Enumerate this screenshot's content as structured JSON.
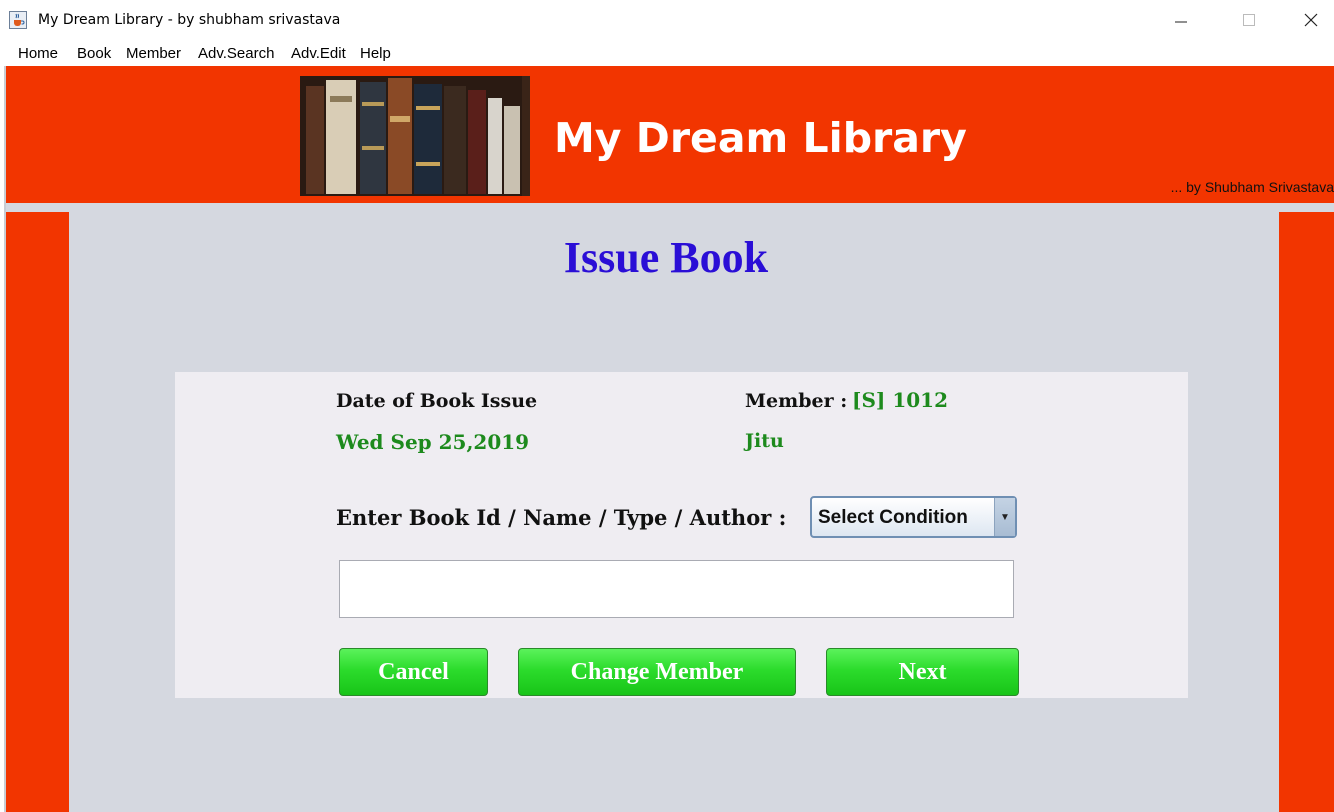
{
  "window": {
    "title": "My Dream Library - by shubham srivastava",
    "controls": {
      "minimize": "–",
      "maximize": "□",
      "close": "✕"
    }
  },
  "menu": {
    "items": [
      {
        "label": "Home"
      },
      {
        "label": "Book"
      },
      {
        "label": "Member"
      },
      {
        "label": "Adv.Search"
      },
      {
        "label": "Adv.Edit"
      },
      {
        "label": "Help"
      }
    ]
  },
  "header": {
    "title": "My Dream Library",
    "byline": "... by Shubham Srivastava",
    "accent_color": "#f23500"
  },
  "page": {
    "title": "Issue Book"
  },
  "form": {
    "date_label": "Date of Book Issue",
    "date_value": "Wed Sep 25,2019",
    "member_label": "Member :",
    "member_id": "[S] 1012",
    "member_name": "Jitu",
    "search_label": "Enter Book Id / Name / Type / Author  :",
    "condition_select": "Select Condition",
    "search_value": ""
  },
  "buttons": {
    "cancel": "Cancel",
    "change_member": "Change Member",
    "next": "Next"
  },
  "icons": {
    "app": "java-cup-icon",
    "dropdown": "triangle-down-icon"
  }
}
